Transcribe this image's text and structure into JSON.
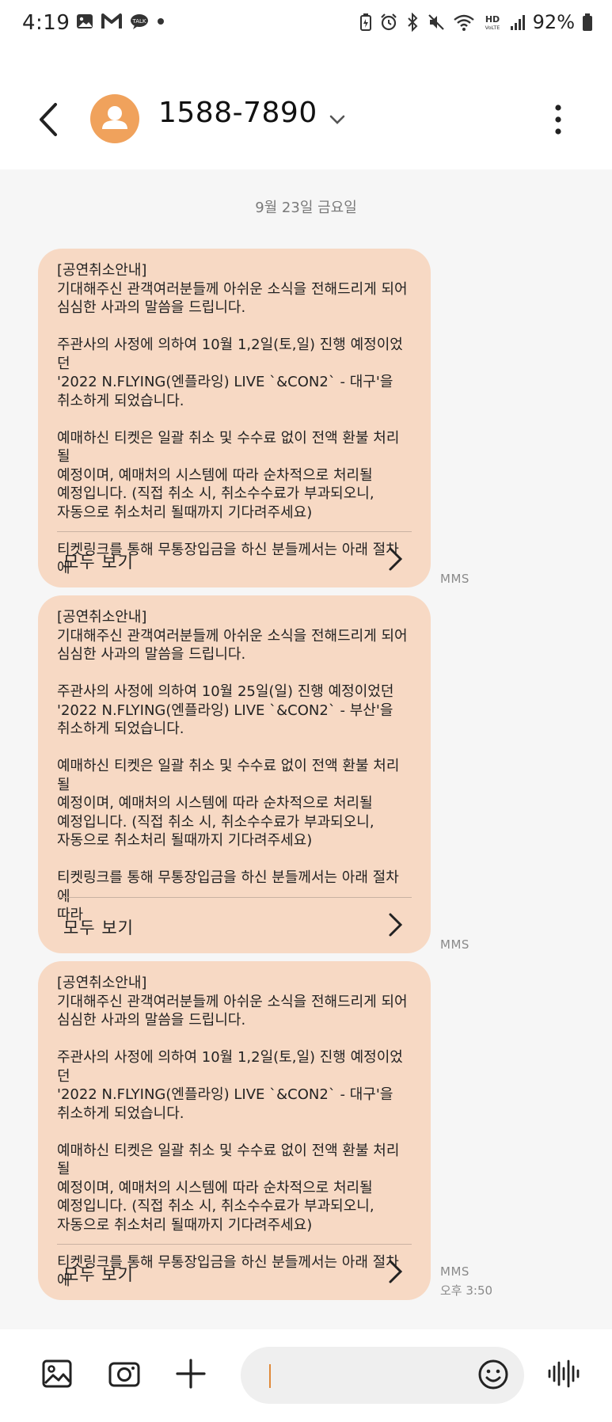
{
  "status_bar": {
    "time": "4:19",
    "battery": "92%",
    "left_icons": [
      "gallery-notification-icon",
      "gmail-icon",
      "talk-icon",
      "dot-icon"
    ],
    "right_icons": [
      "battery-saver-icon",
      "alarm-icon",
      "bluetooth-icon",
      "mute-icon",
      "wifi-icon",
      "hd-voice-icon",
      "signal-icon",
      "battery-icon"
    ],
    "hd_voice": "HD"
  },
  "header": {
    "contact": "1588-7890"
  },
  "chat": {
    "date": "9월 23일 금요일",
    "messages": [
      {
        "text": "[공연취소안내]\n기대해주신 관객여러분들께 아쉬운 소식을 전해드리게 되어\n심심한 사과의 말씀을 드립니다.\n\n주관사의 사정에 의하여 10월 1,2일(토,일) 진행 예정이었던\n'2022 N.FLYING(엔플라잉) LIVE `&CON2` - 대구'을\n취소하게 되었습니다.\n\n예매하신 티켓은 일괄 취소 및 수수료 없이 전액 환불 처리 될\n예정이며, 예매처의 시스템에 따라 순차적으로 처리될\n예정입니다. (직접 취소 시, 취소수수료가 부과되오니,\n자동으로 취소처리 될때까지 기다려주세요)\n\n티켓링크를 통해 무통장입금을 하신 분들께서는 아래 절차에",
        "view_all": "모두 보기",
        "type": "MMS"
      },
      {
        "text": "[공연취소안내]\n기대해주신 관객여러분들께 아쉬운 소식을 전해드리게 되어\n심심한 사과의 말씀을 드립니다.\n\n주관사의 사정에 의하여 10월 25일(일) 진행 예정이었던\n'2022 N.FLYING(엔플라잉) LIVE `&CON2` - 부산'을\n취소하게 되었습니다.\n\n예매하신 티켓은 일괄 취소 및 수수료 없이 전액 환불 처리 될\n예정이며, 예매처의 시스템에 따라 순차적으로 처리될\n예정입니다. (직접 취소 시, 취소수수료가 부과되오니,\n자동으로 취소처리 될때까지 기다려주세요)\n\n티켓링크를 통해 무통장입금을 하신 분들께서는 아래 절차에\n따라",
        "view_all": "모두 보기",
        "type": "MMS"
      },
      {
        "text": "[공연취소안내]\n기대해주신 관객여러분들께 아쉬운 소식을 전해드리게 되어\n심심한 사과의 말씀을 드립니다.\n\n주관사의 사정에 의하여 10월 1,2일(토,일) 진행 예정이었던\n'2022 N.FLYING(엔플라잉) LIVE `&CON2` - 대구'을\n취소하게 되었습니다.\n\n예매하신 티켓은 일괄 취소 및 수수료 없이 전액 환불 처리 될\n예정이며, 예매처의 시스템에 따라 순차적으로 처리될\n예정입니다. (직접 취소 시, 취소수수료가 부과되오니,\n자동으로 취소처리 될때까지 기다려주세요)\n\n티켓링크를 통해 무통장입금을 하신 분들께서는 아래 절차에",
        "view_all": "모두 보기",
        "type": "MMS",
        "time": "오후 3:50"
      }
    ]
  },
  "bottom_bar": {
    "buttons": [
      "gallery-icon",
      "camera-icon",
      "plus-icon",
      "emoji-icon",
      "voice-input-icon"
    ]
  },
  "colors": {
    "bubble": "#f7d9c4",
    "avatar": "#f0a25c",
    "caret": "#e08a3a",
    "chat_bg": "#f6f6f6"
  }
}
